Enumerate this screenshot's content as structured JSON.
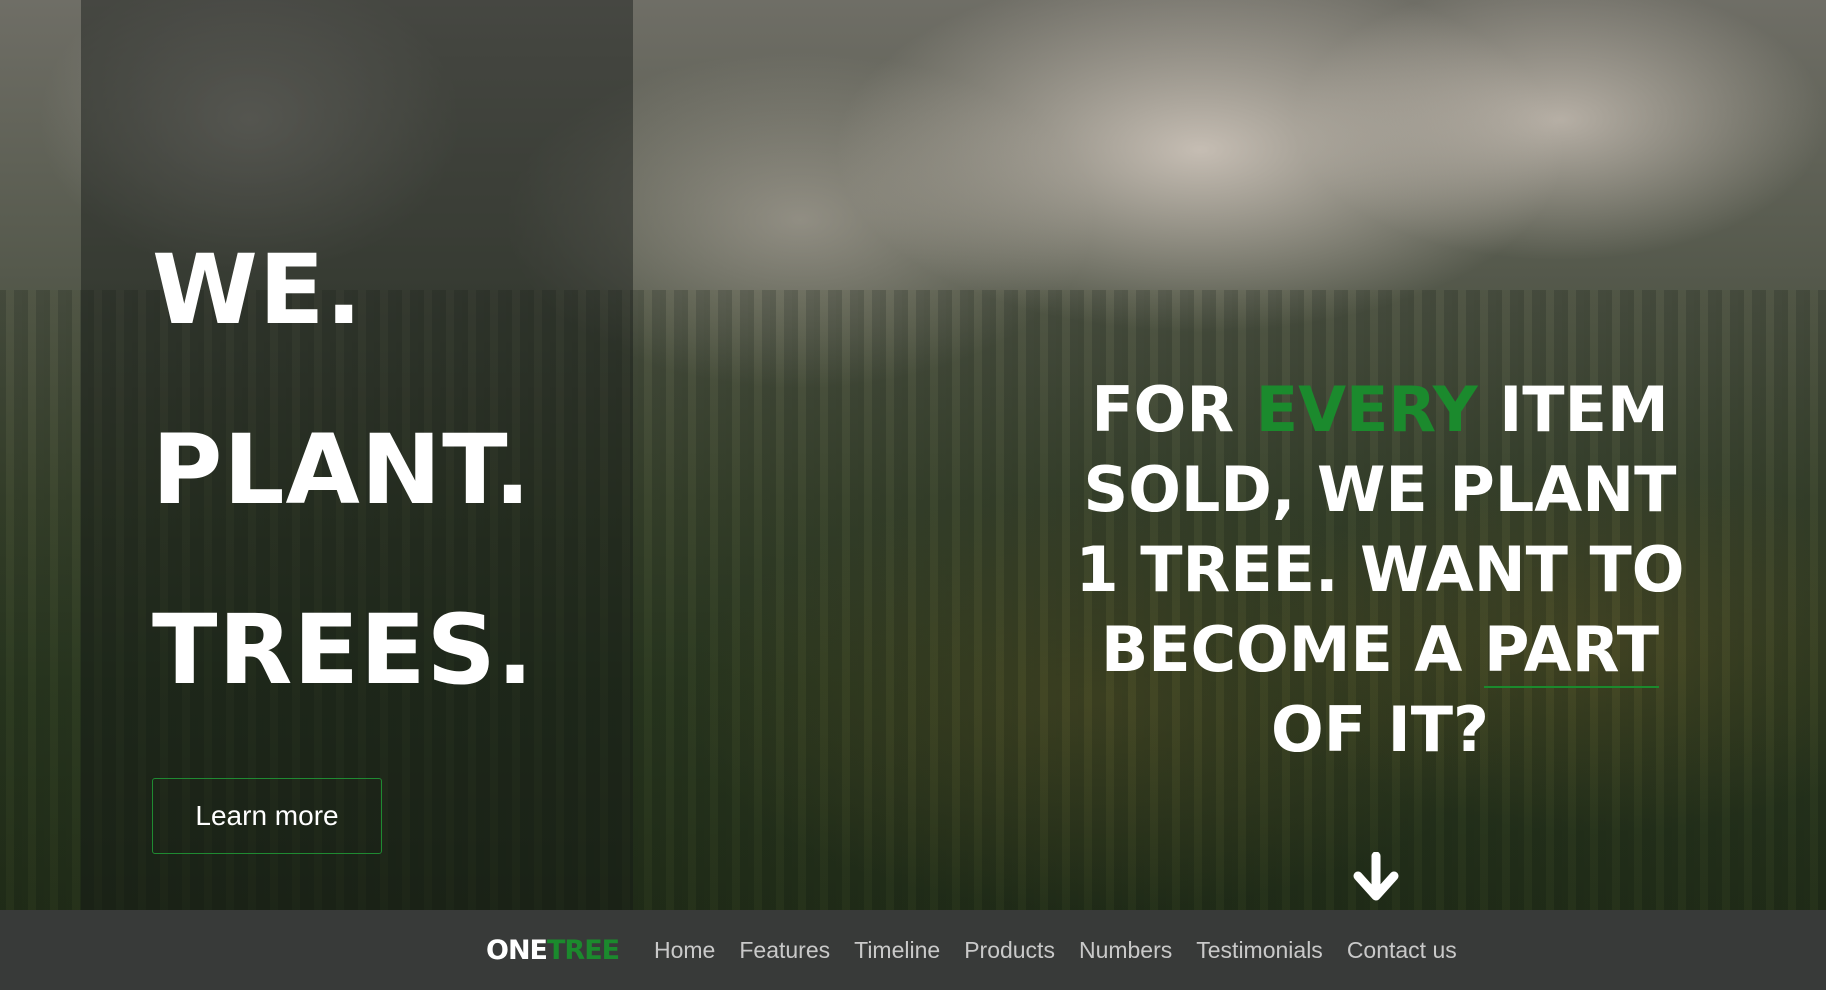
{
  "hero": {
    "headline": [
      "WE.",
      "PLANT.",
      "TREES."
    ],
    "cta_label": "Learn more",
    "tagline": {
      "part1": "FOR ",
      "highlight": "EVERY",
      "part2": " ITEM SOLD, WE PLANT 1 TREE. WANT TO BECOME A ",
      "underlined": "PART",
      "part3": " OF IT?"
    },
    "scroll_icon": "arrow-down-icon"
  },
  "navbar": {
    "brand_one": "ONE",
    "brand_tree": "TREE",
    "links": [
      "Home",
      "Features",
      "Timeline",
      "Products",
      "Numbers",
      "Testimonials",
      "Contact us"
    ]
  },
  "colors": {
    "accent_green": "#1b8a2d",
    "navbar_bg": "#383a39",
    "text_white": "#ffffff"
  }
}
